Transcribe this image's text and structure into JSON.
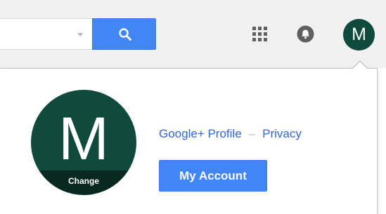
{
  "header": {
    "search_placeholder": "",
    "search_icon": "search-icon",
    "apps_icon": "apps-grid-icon",
    "notifications_icon": "bell-icon",
    "account_initial": "M"
  },
  "account_panel": {
    "avatar_initial": "M",
    "change_label": "Change",
    "google_plus_profile_label": "Google+ Profile",
    "separator": "–",
    "privacy_label": "Privacy",
    "my_account_label": "My Account"
  },
  "colors": {
    "accent": "#4285f4",
    "avatar": "#0f4a3c",
    "link": "#3367d6",
    "topbar": "#f1f1f1"
  }
}
